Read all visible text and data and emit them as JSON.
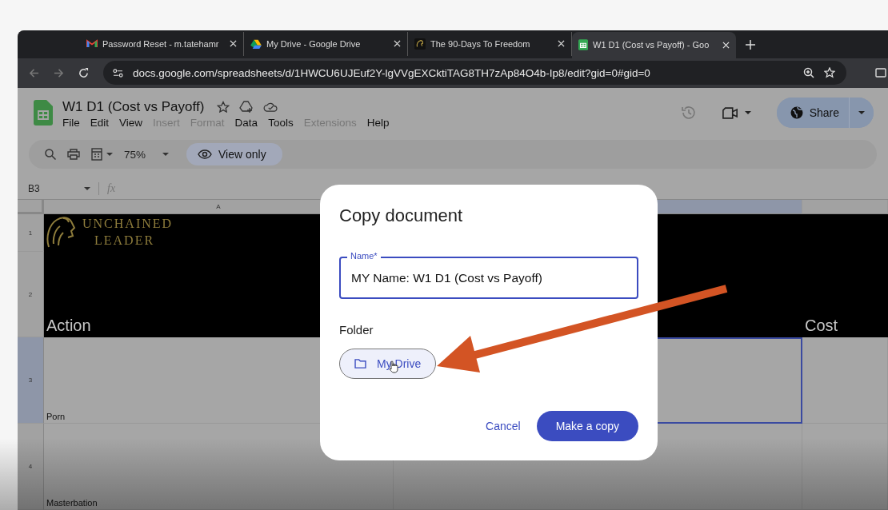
{
  "browser": {
    "tabs": [
      {
        "title": "Password Reset - m.tatehamr",
        "kind": "mail",
        "selected": false
      },
      {
        "title": "My Drive - Google Drive",
        "kind": "drive",
        "selected": false
      },
      {
        "title": "The 90-Days To Freedom",
        "kind": "lion",
        "selected": false
      },
      {
        "title": "W1 D1 (Cost vs Payoff) - Goo",
        "kind": "sheet",
        "selected": true
      }
    ],
    "url": "docs.google.com/spreadsheets/d/1HWCU6UJEuf2Y-lgVVgEXCktiTAG8TH7zAp84O4b-Ip8/edit?gid=0#gid=0"
  },
  "sheet": {
    "title": "W1 D1 (Cost vs Payoff)",
    "menu": [
      {
        "label": "File",
        "disabled": false
      },
      {
        "label": "Edit",
        "disabled": false
      },
      {
        "label": "View",
        "disabled": false
      },
      {
        "label": "Insert",
        "disabled": true
      },
      {
        "label": "Format",
        "disabled": true
      },
      {
        "label": "Data",
        "disabled": false
      },
      {
        "label": "Tools",
        "disabled": false
      },
      {
        "label": "Extensions",
        "disabled": true
      },
      {
        "label": "Help",
        "disabled": false
      }
    ],
    "share": "Share",
    "zoom": "75%",
    "view_only": "View only",
    "name_box": "B3",
    "fx": "fx",
    "columns": [
      {
        "label": "A",
        "selected": false
      },
      {
        "selected": true
      },
      {
        "selected": false
      }
    ],
    "logo": [
      "UNCHAINED",
      "LEADER"
    ],
    "rows": [
      {
        "number": "1",
        "selected": false,
        "header": true,
        "cells": []
      },
      {
        "number": "2",
        "selected": false,
        "header": true,
        "cells": [
          "Action",
          null,
          "Cost"
        ]
      },
      {
        "number": "3",
        "selected": true,
        "header": false,
        "cells": [
          "Porn",
          null,
          null
        ]
      },
      {
        "number": "4",
        "selected": false,
        "header": false,
        "cells": [
          "Masterbation",
          null,
          null
        ]
      }
    ]
  },
  "dialog": {
    "title": "Copy document",
    "field_label": "Name*",
    "field_value": "MY Name: W1 D1 (Cost vs Payoff)",
    "folder_label": "Folder",
    "folder": "My Drive",
    "cancel": "Cancel",
    "confirm": "Make a copy"
  }
}
